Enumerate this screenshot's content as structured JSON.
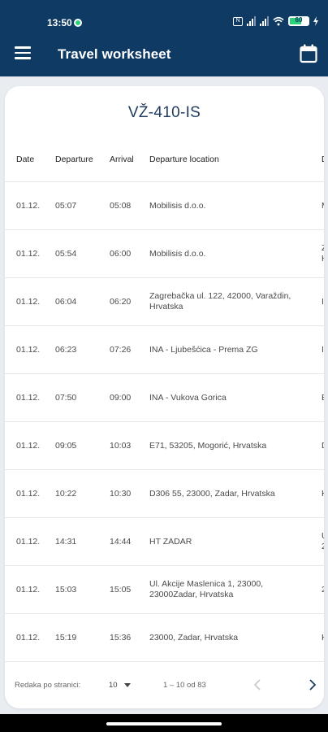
{
  "status_bar": {
    "time": "13:50",
    "battery": "60"
  },
  "app_bar": {
    "title": "Travel worksheet",
    "menu_icon": "hamburger-menu-icon",
    "calendar_icon": "calendar-icon"
  },
  "vehicle": {
    "plate": "VŽ-410-IS"
  },
  "table": {
    "columns": [
      "Date",
      "Departure",
      "Arrival",
      "Departure location",
      "D"
    ],
    "rows": [
      {
        "date": "01.12.",
        "departure": "05:07",
        "arrival": "05:08",
        "location": "Mobilisis d.o.o.",
        "next": "M"
      },
      {
        "date": "01.12.",
        "departure": "05:54",
        "arrival": "06:00",
        "location": "Mobilisis d.o.o.",
        "next": "Z H"
      },
      {
        "date": "01.12.",
        "departure": "06:04",
        "arrival": "06:20",
        "location": "Zagrebačka ul. 122, 42000, Varaždin, Hrvatska",
        "next": "I"
      },
      {
        "date": "01.12.",
        "departure": "06:23",
        "arrival": "07:26",
        "location": "INA - Ljubešćica - Prema ZG",
        "next": "I"
      },
      {
        "date": "01.12.",
        "departure": "07:50",
        "arrival": "09:00",
        "location": "INA - Vukova Gorica",
        "next": "E"
      },
      {
        "date": "01.12.",
        "departure": "09:05",
        "arrival": "10:03",
        "location": "E71, 53205, Mogorić, Hrvatska",
        "next": "D"
      },
      {
        "date": "01.12.",
        "departure": "10:22",
        "arrival": "10:30",
        "location": "D306 55, 23000, Zadar, Hrvatska",
        "next": "H"
      },
      {
        "date": "01.12.",
        "departure": "14:31",
        "arrival": "14:44",
        "location": "HT ZADAR",
        "next": "U 2"
      },
      {
        "date": "01.12.",
        "departure": "15:03",
        "arrival": "15:05",
        "location": "Ul. Akcije Maslenica 1, 23000, 23000Zadar, Hrvatska",
        "next": "2"
      },
      {
        "date": "01.12.",
        "departure": "15:19",
        "arrival": "15:36",
        "location": "23000, Zadar, Hrvatska",
        "next": "H"
      }
    ]
  },
  "pagination": {
    "rows_per_page_label": "Redaka po stranici:",
    "rows_per_page": "10",
    "range": "1 – 10 od 83",
    "prev_icon": "chevron-left-icon",
    "next_icon": "chevron-right-icon"
  },
  "colors": {
    "app_bar": "#0f3a63",
    "background": "#e9edf1",
    "card": "#ffffff",
    "plate_text": "#1f3b5e",
    "status_dot": "#2bd07a"
  }
}
